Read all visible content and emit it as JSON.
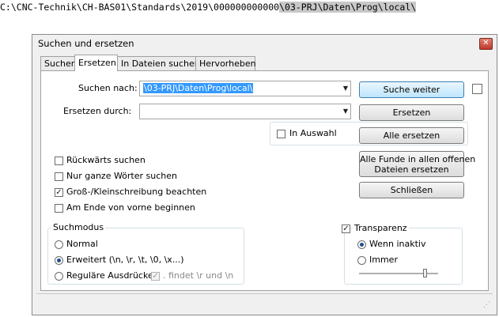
{
  "editor": {
    "path_prefix": "C:\\CNC-Technik\\CH-BAS01\\Standards\\2019\\000000000000",
    "path_selected": "\\03-PRJ\\Daten\\Prog\\local\\"
  },
  "dialog": {
    "title": "Suchen und ersetzen",
    "close_glyph": "✕",
    "tabs": [
      "Suchen",
      "Ersetzen",
      "In Dateien suchen",
      "Hervorheben"
    ],
    "active_tab": "Ersetzen",
    "find_label": "Suchen nach:",
    "find_value": "\\03-PRJ\\Daten\\Prog\\local\\",
    "replace_label": "Ersetzen durch:",
    "replace_value": "",
    "buttons": {
      "find_next": "Suche weiter",
      "replace": "Ersetzen",
      "replace_all": "Alle ersetzen",
      "replace_all_open_line1": "Alle Funde in allen offenen",
      "replace_all_open_line2": "Dateien ersetzen",
      "close": "Schließen"
    },
    "in_selection": "In Auswahl",
    "options": [
      {
        "label": "Rückwärts suchen",
        "checked": false
      },
      {
        "label": "Nur ganze Wörter suchen",
        "checked": false
      },
      {
        "label": "Groß-/Kleinschreibung beachten",
        "checked": true
      },
      {
        "label": "Am Ende von vorne beginnen",
        "checked": false
      }
    ],
    "search_mode": {
      "title": "Suchmodus",
      "normal": "Normal",
      "extended": "Erweitert (\\n, \\r, \\t, \\0, \\x...)",
      "regex": "Reguläre Ausdrücke",
      "dot_newline": ". findet \\r und \\n",
      "selected": "extended"
    },
    "transparency": {
      "title": "Transparenz",
      "checked": true,
      "on_inactive": "Wenn inaktiv",
      "always": "Immer",
      "selected": "on_inactive",
      "slider_level": 0.85
    },
    "check_glyph": "✓"
  }
}
